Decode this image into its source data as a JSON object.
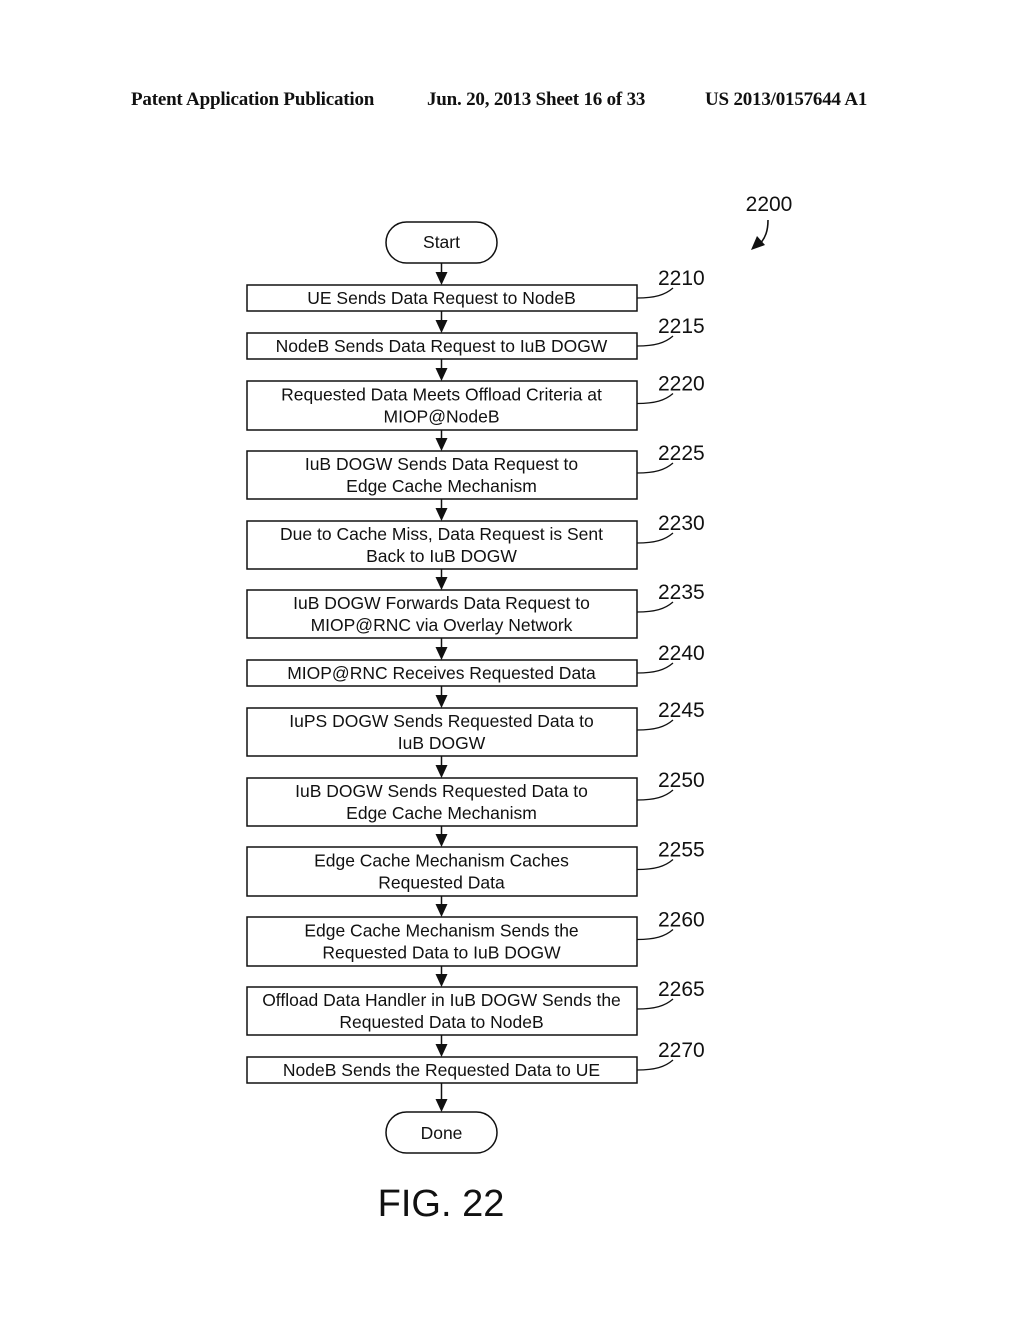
{
  "header": {
    "left": "Patent Application Publication",
    "middle": "Jun. 20, 2013  Sheet 16 of 33",
    "right": "US 2013/0157644 A1"
  },
  "diagram": {
    "figure_ref": "2200",
    "figure_label": "FIG. 22",
    "start_label": "Start",
    "end_label": "Done",
    "steps": [
      {
        "ref": "2210",
        "lines": [
          "UE Sends Data Request to NodeB"
        ]
      },
      {
        "ref": "2215",
        "lines": [
          "NodeB Sends Data Request to IuB DOGW"
        ]
      },
      {
        "ref": "2220",
        "lines": [
          "Requested Data Meets Offload Criteria at",
          "MIOP@NodeB"
        ]
      },
      {
        "ref": "2225",
        "lines": [
          "IuB DOGW Sends Data Request to",
          "Edge Cache Mechanism"
        ]
      },
      {
        "ref": "2230",
        "lines": [
          "Due to Cache Miss, Data Request is Sent",
          "Back to IuB DOGW"
        ]
      },
      {
        "ref": "2235",
        "lines": [
          "IuB DOGW Forwards Data Request to",
          "MIOP@RNC via Overlay Network"
        ]
      },
      {
        "ref": "2240",
        "lines": [
          "MIOP@RNC Receives Requested Data"
        ]
      },
      {
        "ref": "2245",
        "lines": [
          "IuPS DOGW Sends Requested Data to",
          "IuB DOGW"
        ]
      },
      {
        "ref": "2250",
        "lines": [
          "IuB DOGW Sends Requested Data to",
          "Edge Cache Mechanism"
        ]
      },
      {
        "ref": "2255",
        "lines": [
          "Edge Cache Mechanism Caches",
          "Requested Data"
        ]
      },
      {
        "ref": "2260",
        "lines": [
          "Edge Cache Mechanism Sends the",
          "Requested Data to IuB DOGW"
        ]
      },
      {
        "ref": "2265",
        "lines": [
          "Offload Data Handler in IuB DOGW Sends the",
          "Requested Data to NodeB"
        ]
      },
      {
        "ref": "2270",
        "lines": [
          "NodeB Sends the Requested Data to UE"
        ]
      }
    ]
  }
}
